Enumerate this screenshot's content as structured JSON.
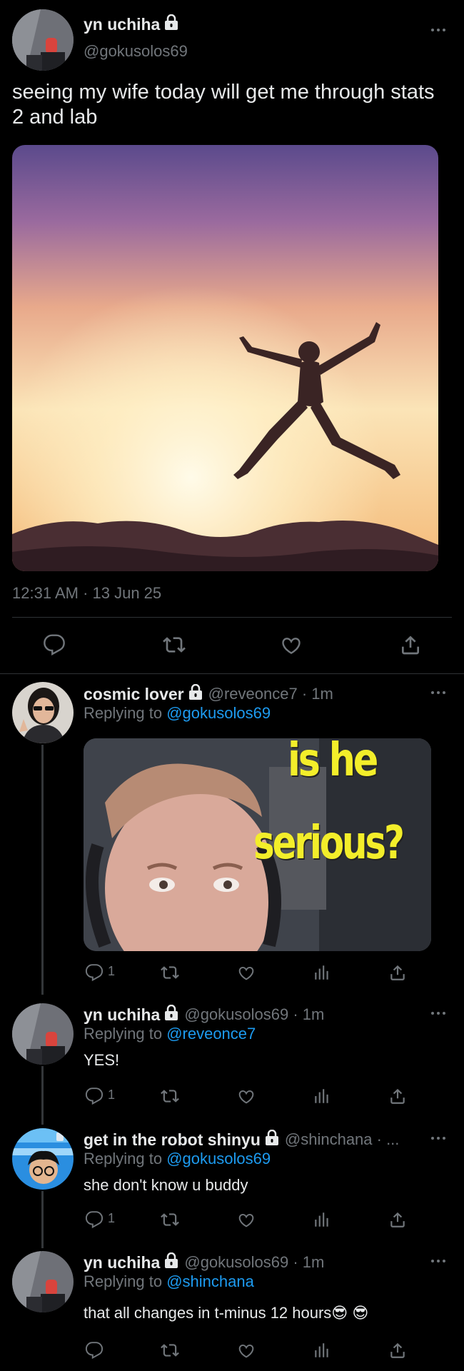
{
  "main_tweet": {
    "display_name": "yn uchiha",
    "handle": "@gokusolos69",
    "text": "seeing my wife today will get me through stats 2 and lab",
    "timestamp": "12:31 AM · 13 Jun 25"
  },
  "replies": [
    {
      "display_name": "cosmic lover",
      "handle_time": "@reveonce7 · 1m",
      "replying_prefix": "Replying to ",
      "replying_to": "@gokusolos69",
      "meme_text_1": "is he",
      "meme_text_2": "serious?",
      "reply_count": "1"
    },
    {
      "display_name": "yn uchiha",
      "handle_time": "@gokusolos69 · 1m",
      "replying_prefix": "Replying to ",
      "replying_to": "@reveonce7",
      "text": "YES!",
      "reply_count": "1"
    },
    {
      "display_name": "get in the robot shinyu",
      "handle_time": "@shinchana · ...",
      "replying_prefix": "Replying to ",
      "replying_to": "@gokusolos69",
      "text": "she don't know u buddy",
      "reply_count": "1"
    },
    {
      "display_name": "yn uchiha",
      "handle_time": "@gokusolos69 · 1m",
      "replying_prefix": "Replying to ",
      "replying_to": "@shinchana",
      "text": "that all changes in t-minus 12 hours😎 😎"
    }
  ],
  "colors": {
    "background": "#000000",
    "text": "#e7e9ea",
    "muted": "#71767b",
    "link": "#1d9bf0",
    "divider": "#2f3336"
  },
  "icons": [
    "lock-icon",
    "more-icon",
    "reply-icon",
    "retweet-icon",
    "like-icon",
    "share-icon",
    "views-icon"
  ]
}
